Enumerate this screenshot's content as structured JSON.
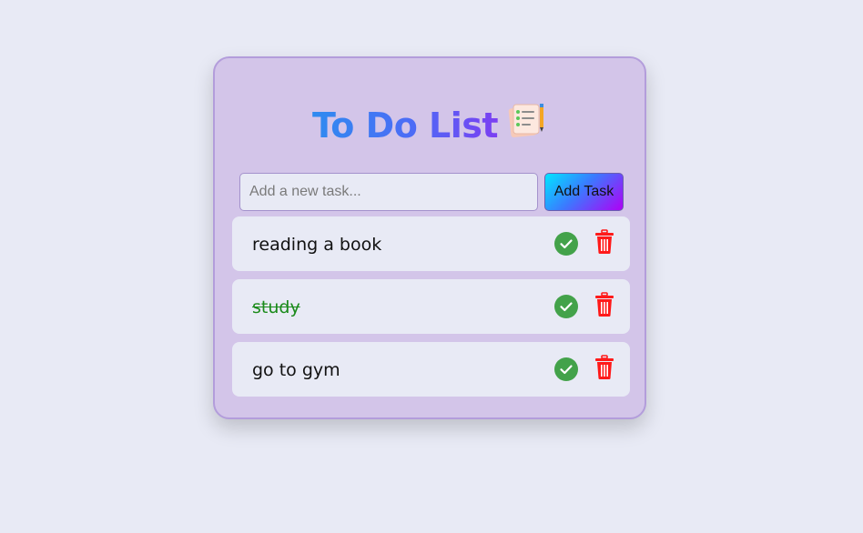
{
  "header": {
    "title": "To Do List"
  },
  "input": {
    "placeholder": "Add a new task...",
    "value": ""
  },
  "add_button": {
    "label": "Add Task"
  },
  "tasks": [
    {
      "text": "reading a book",
      "completed": false
    },
    {
      "text": "study",
      "completed": true
    },
    {
      "text": "go to gym",
      "completed": false
    }
  ],
  "icons": {
    "title": "checklist-notepad-icon",
    "complete": "check-circle-icon",
    "delete": "trash-icon"
  },
  "colors": {
    "page_background": "#e8eaf5",
    "card_background": "#d3c5e9",
    "card_border": "#b39ddb",
    "check": "#43a24a",
    "trash": "#ff1a1a",
    "done_text": "#1a8a1a"
  }
}
